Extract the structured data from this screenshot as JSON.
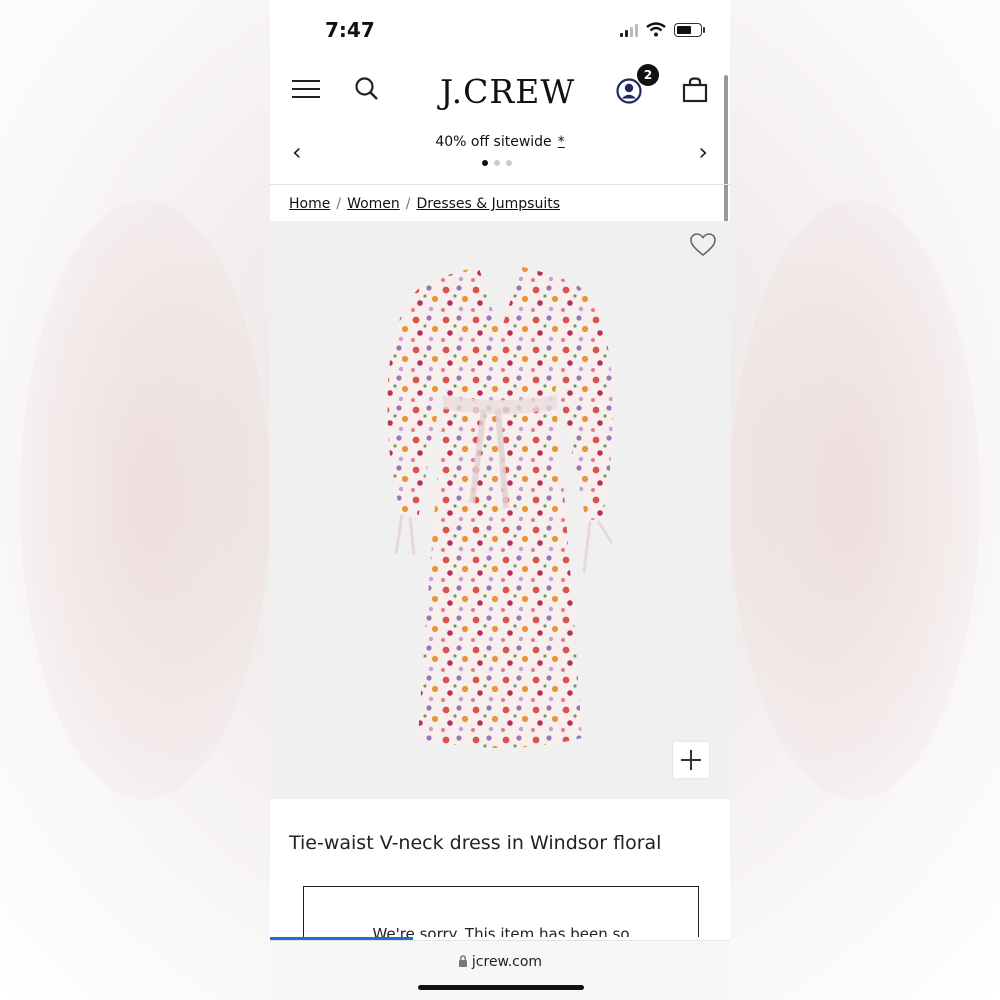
{
  "status_bar": {
    "time": "7:47"
  },
  "header": {
    "logo": "J.CREW",
    "account_badge": "2"
  },
  "promo": {
    "text": "40% off sitewide",
    "star": "*",
    "slides": 3,
    "active_slide": 1
  },
  "breadcrumb": {
    "items": [
      "Home",
      "Women",
      "Dresses & Jumpsuits"
    ],
    "separator": "/"
  },
  "product": {
    "title": "Tie-waist V-neck dress in Windsor floral",
    "notice": "We're sorry. This item has been so"
  },
  "browser": {
    "url": "jcrew.com",
    "load_progress": 0.31
  },
  "icons": [
    "menu-icon",
    "search-icon",
    "account-icon",
    "bag-icon",
    "chevron-left-icon",
    "chevron-right-icon",
    "heart-icon",
    "plus-icon",
    "lock-icon"
  ],
  "colors": {
    "accent_blue": "#1b6fd6",
    "account_icon": "#1e2a5a",
    "image_bg": "#f1f0f0"
  }
}
